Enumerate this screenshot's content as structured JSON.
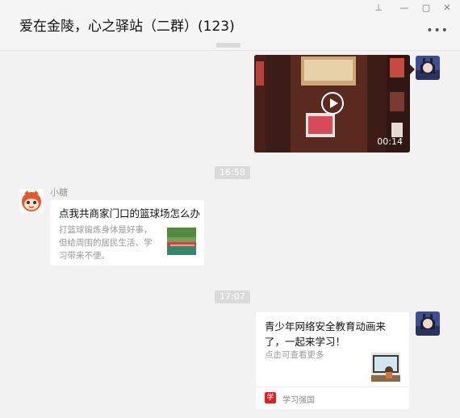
{
  "window": {
    "title": "爱在金陵，心之驿站（二群）(123)",
    "controls": {
      "pin": "⊥",
      "minimize": "—",
      "maximize": "▢",
      "close": "✕"
    },
    "more_label": "•••"
  },
  "messages": {
    "video": {
      "duration": "00:14"
    },
    "time1": "16:58",
    "link1": {
      "sender": "小糖",
      "title": "点我共商家门口的篮球场怎么办",
      "desc": "打篮球锻炼身体是好事，但给周围的居民生活、学习带来不便。"
    },
    "time2": "17:07",
    "link2": {
      "title": "青少年网络安全教育动画来了，一起来学习！",
      "desc": "点击可查看更多",
      "source": "学习强国",
      "source_icon": "学"
    }
  },
  "colors": {
    "background": "#f2f2f2",
    "card": "#ffffff",
    "badge": "#dadada",
    "brand_red": "#e02020"
  }
}
